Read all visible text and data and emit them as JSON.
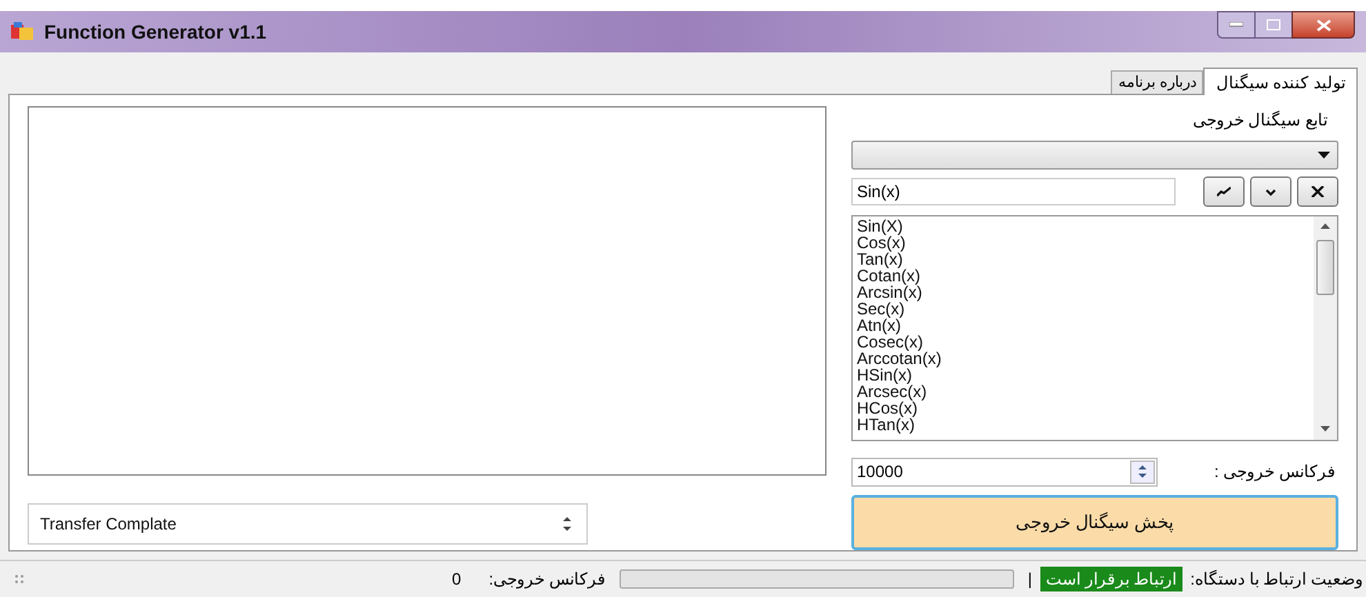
{
  "window": {
    "title": "Function Generator v1.1"
  },
  "tabs": [
    {
      "label": "تولید کننده سیگنال",
      "selected": true
    },
    {
      "label": "درباره برنامه",
      "selected": false
    }
  ],
  "status_message": "Transfer Complate",
  "signal_panel": {
    "label": "تابع سیگنال خروجی",
    "function_field": {
      "value": "Sin(x)"
    },
    "functions": [
      {
        "label": "Sin(X)",
        "selected": false
      },
      {
        "label": "Cos(x)",
        "selected": false
      },
      {
        "label": "Tan(x)",
        "selected": false
      },
      {
        "label": "Cotan(x)",
        "selected": false
      },
      {
        "label": "Arcsin(x)",
        "selected": false
      },
      {
        "label": "Sec(x)",
        "selected": false
      },
      {
        "label": "Atn(x)",
        "selected": false
      },
      {
        "label": "Cosec(x)",
        "selected": false
      },
      {
        "label": "Arccotan(x)",
        "selected": false
      },
      {
        "label": "HSin(x)",
        "selected": false
      },
      {
        "label": "Arcsec(x)",
        "selected": false
      },
      {
        "label": "HCos(x)",
        "selected": false
      },
      {
        "label": "HTan(x)",
        "selected": false
      }
    ],
    "frequency": {
      "label": "فرکانس خروجی :",
      "value": "10000"
    },
    "play_button": "پخش سیگنال خروجی"
  },
  "status_bar": {
    "connection_label": "وضعیت ارتباط با دستگاه:",
    "connection_status": "ارتباط برقرار است",
    "separator": "|",
    "frequency_label": "فرکانس خروجی:",
    "frequency_value": "0"
  }
}
